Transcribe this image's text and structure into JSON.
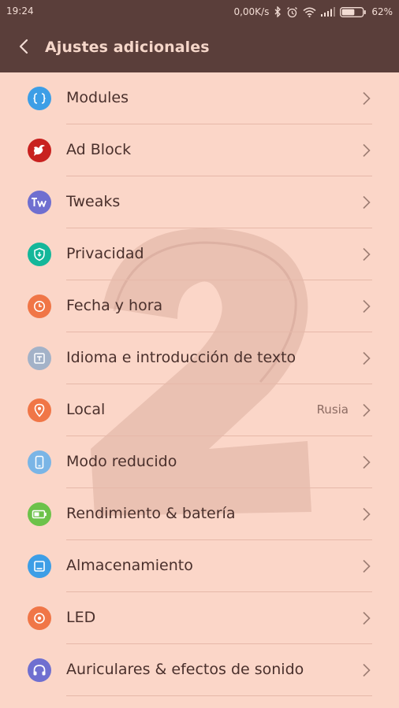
{
  "status_bar": {
    "time": "19:24",
    "network_speed": "0,00K/s",
    "battery_percent": "62%",
    "battery_level": 0.62,
    "icons": [
      "bluetooth-icon",
      "alarm-icon",
      "wifi-icon",
      "signal-icon",
      "battery-icon"
    ]
  },
  "header": {
    "title": "Ajustes adicionales",
    "back_icon": "chevron-left-icon"
  },
  "items": [
    {
      "label": "Modules",
      "value": "",
      "icon": "modules-icon",
      "color": "#3d9ee6"
    },
    {
      "label": "Ad Block",
      "value": "",
      "icon": "adblock-icon",
      "color": "#c8211f"
    },
    {
      "label": "Tweaks",
      "value": "",
      "icon": "tweaks-icon",
      "color": "#6f6fd0"
    },
    {
      "label": "Privacidad",
      "value": "",
      "icon": "shield-icon",
      "color": "#14b79a"
    },
    {
      "label": "Fecha y hora",
      "value": "",
      "icon": "clock-icon",
      "color": "#f07647"
    },
    {
      "label": "Idioma e introducción de texto",
      "value": "",
      "icon": "keyboard-icon",
      "color": "#a3b2c8"
    },
    {
      "label": "Local",
      "value": "Rusia",
      "icon": "location-icon",
      "color": "#f07647"
    },
    {
      "label": "Modo reducido",
      "value": "",
      "icon": "phone-icon",
      "color": "#7ab5e6"
    },
    {
      "label": "Rendimiento & batería",
      "value": "",
      "icon": "battery-icon",
      "color": "#6cc24a"
    },
    {
      "label": "Almacenamiento",
      "value": "",
      "icon": "storage-icon",
      "color": "#3d9ee6"
    },
    {
      "label": "LED",
      "value": "",
      "icon": "led-icon",
      "color": "#f07647"
    },
    {
      "label": "Auriculares & efectos de sonido",
      "value": "",
      "icon": "headphones-icon",
      "color": "#6f6fd0"
    }
  ]
}
